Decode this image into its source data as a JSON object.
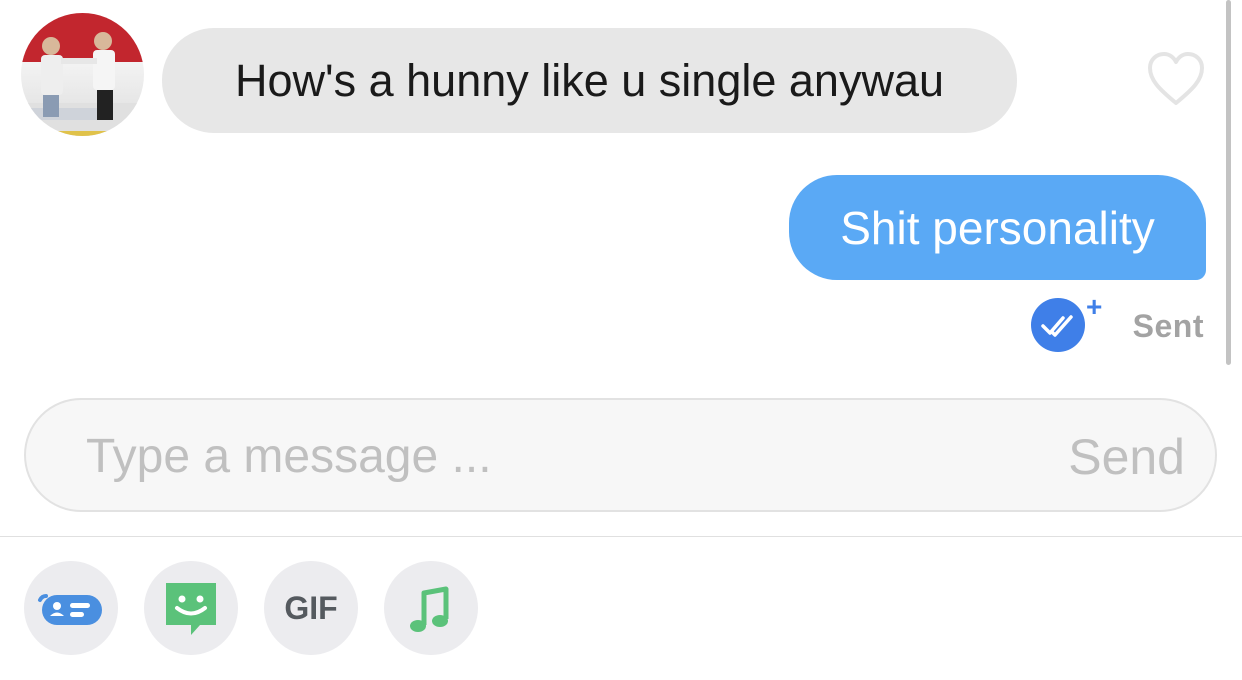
{
  "conversation": {
    "incoming_message": {
      "text": "How's a hunny like u single anywau",
      "avatar_icon": "profile-photo",
      "like_icon": "heart-outline-icon"
    },
    "outgoing_message": {
      "text": "Shit personality",
      "status": "Sent",
      "status_icon": "double-check-icon"
    }
  },
  "composer": {
    "placeholder": "Type a message ...",
    "send_label": "Send"
  },
  "toolbar": {
    "items": [
      {
        "icon": "contact-card-icon"
      },
      {
        "icon": "sticker-icon"
      },
      {
        "label": "GIF"
      },
      {
        "icon": "music-note-icon"
      }
    ]
  },
  "colors": {
    "incoming_bubble": "#e7e7e7",
    "outgoing_bubble": "#5aa9f5",
    "accent_blue": "#3f7fe8",
    "sticker_green": "#5bc27a"
  }
}
